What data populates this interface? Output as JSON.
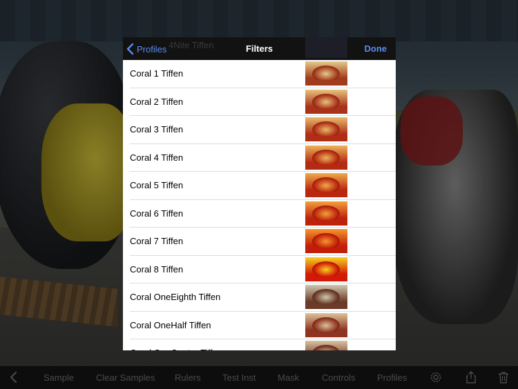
{
  "popover": {
    "ghost_text": "4Nite Tiffen",
    "back_label": "Profiles",
    "title": "Filters",
    "done_label": "Done"
  },
  "filters": [
    {
      "label": "Coral 1 Tiffen",
      "tint": "#a23a1c",
      "light": "#e6c98a"
    },
    {
      "label": "Coral 2 Tiffen",
      "tint": "#a8321a",
      "light": "#e8c27c"
    },
    {
      "label": "Coral 3 Tiffen",
      "tint": "#b02e16",
      "light": "#eab96a"
    },
    {
      "label": "Coral 4 Tiffen",
      "tint": "#b52a12",
      "light": "#eeb25a"
    },
    {
      "label": "Coral 5 Tiffen",
      "tint": "#ba260e",
      "light": "#f0aa4a"
    },
    {
      "label": "Coral 6 Tiffen",
      "tint": "#bd220c",
      "light": "#f3a03c"
    },
    {
      "label": "Coral 7 Tiffen",
      "tint": "#c21e08",
      "light": "#f5962e"
    },
    {
      "label": "Coral 8 Tiffen",
      "tint": "#d21a06",
      "light": "#f8d020"
    },
    {
      "label": "Coral OneEighth Tiffen",
      "tint": "#6b3a28",
      "light": "#cfc8b0"
    },
    {
      "label": "Coral OneHalf Tiffen",
      "tint": "#8e3420",
      "light": "#dcc29a"
    },
    {
      "label": "Coral OneQuater Tiffen",
      "tint": "#7c3624",
      "light": "#d6c4a4"
    }
  ],
  "toolbar": {
    "back_icon": "chevron-left-icon",
    "sample": "Sample",
    "clear_samples": "Clear Samples",
    "rulers": "Rulers",
    "test_inst": "Test Inst",
    "mask": "Mask",
    "controls": "Controls",
    "profiles": "Profiles",
    "settings_icon": "gear-icon",
    "share_icon": "share-icon",
    "trash_icon": "trash-icon"
  }
}
